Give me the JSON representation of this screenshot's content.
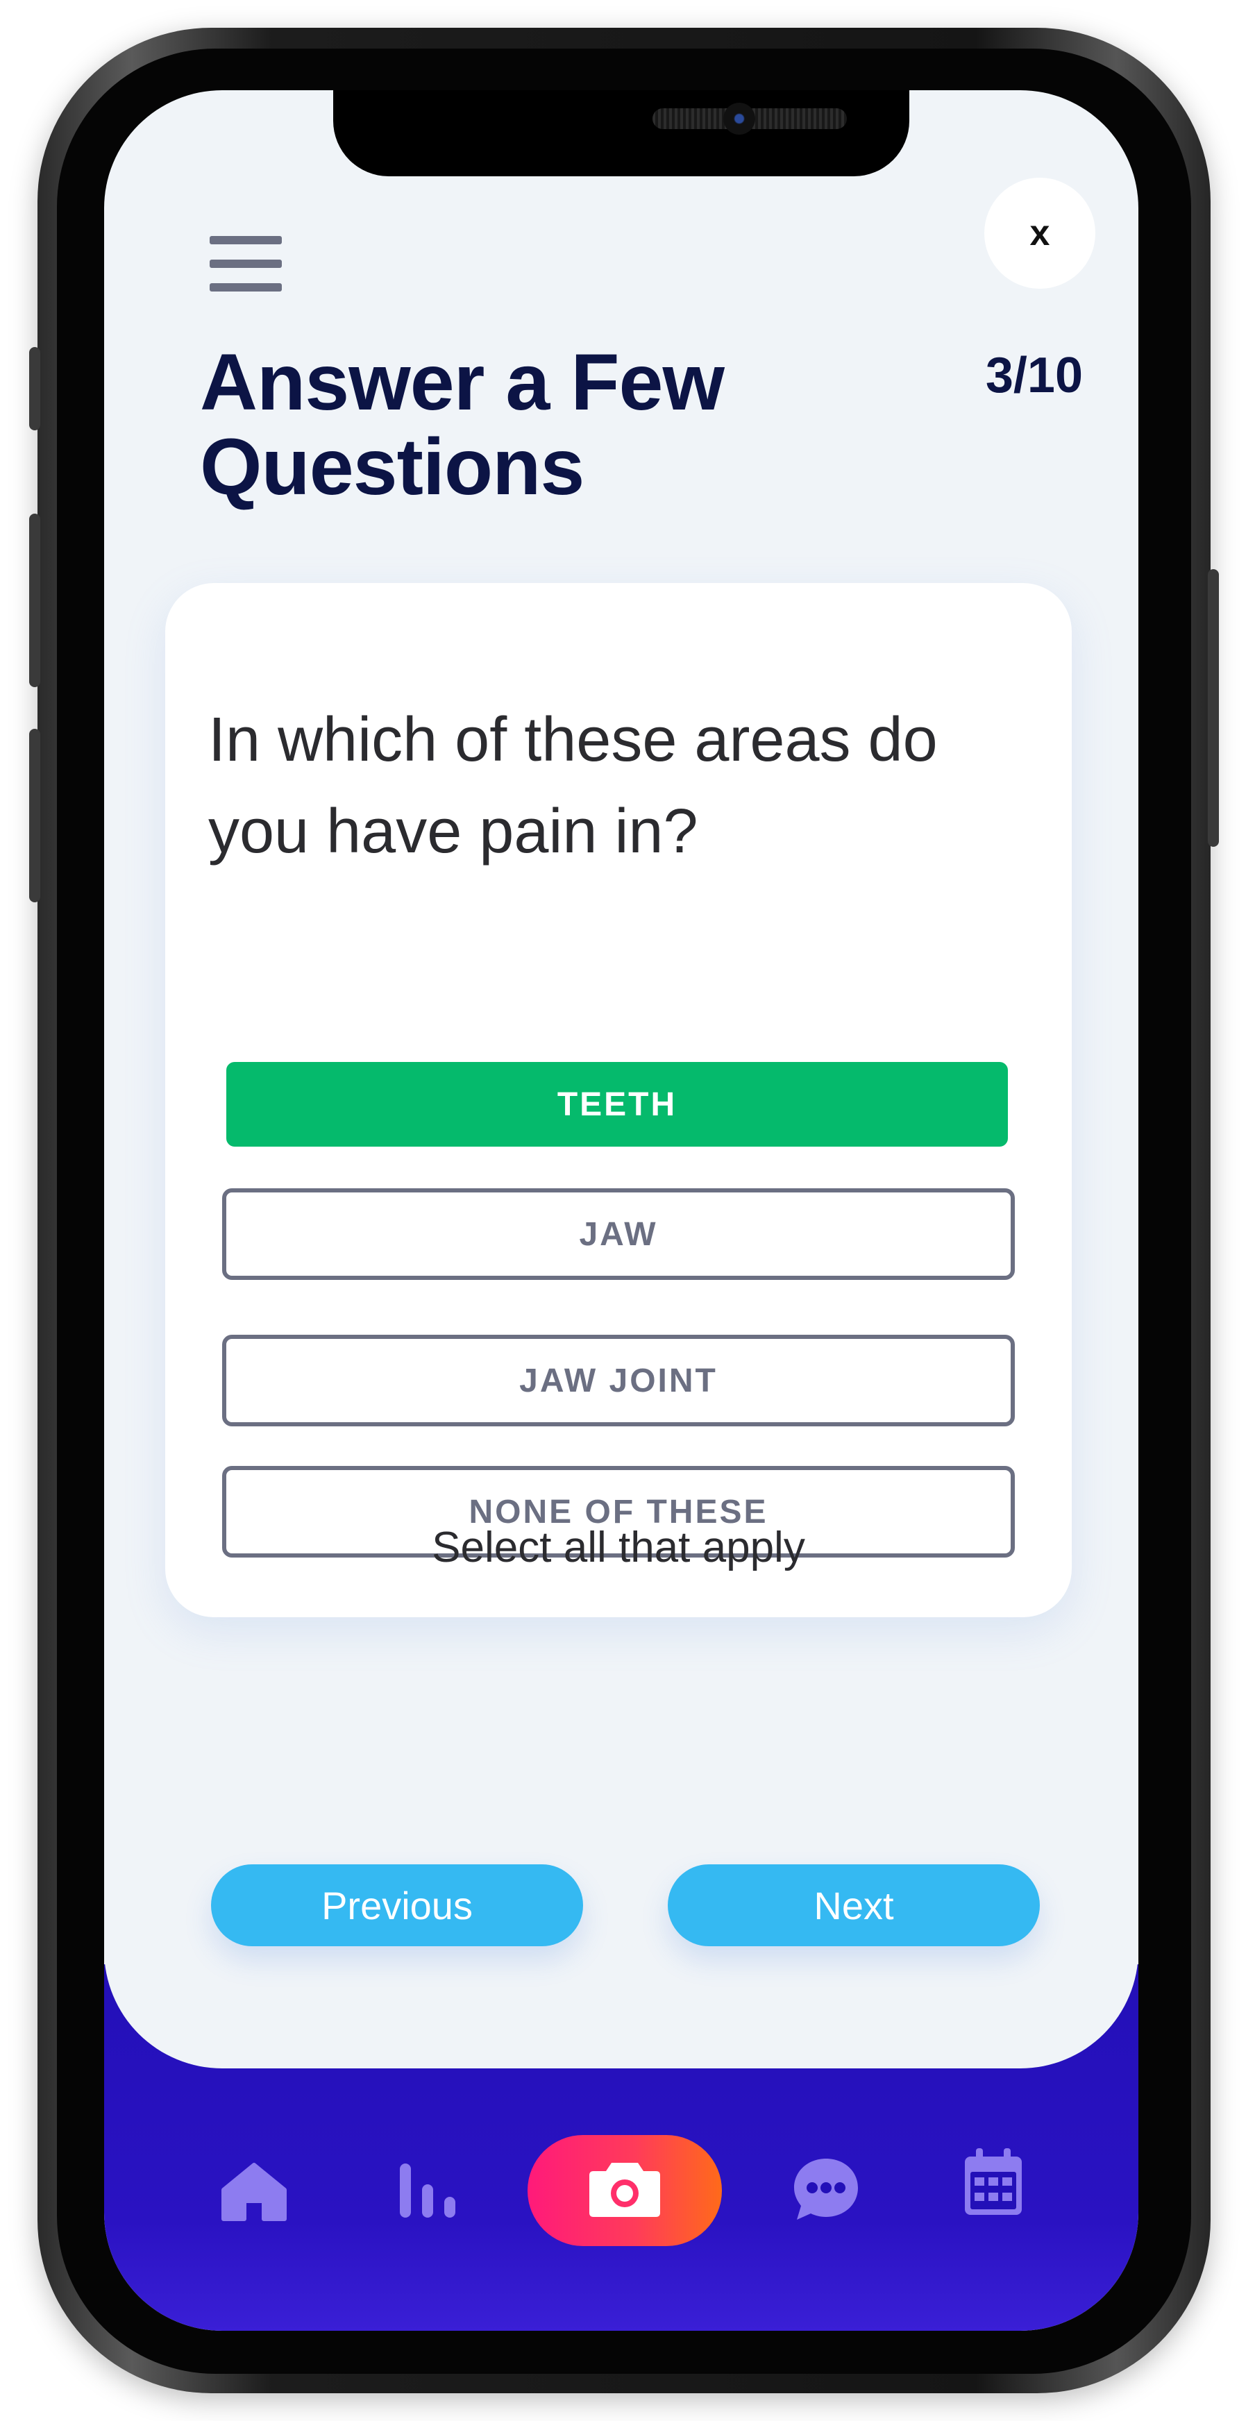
{
  "header": {
    "close_label": "x",
    "title": "Answer a Few Questions",
    "progress": "3/10"
  },
  "question": {
    "text": "In which of these areas do you have pain in?",
    "options": [
      {
        "label": "TEETH",
        "selected": true
      },
      {
        "label": "JAW",
        "selected": false
      },
      {
        "label": "JAW JOINT",
        "selected": false
      },
      {
        "label": "NONE OF THESE",
        "selected": false
      }
    ],
    "helper": "Select all that apply"
  },
  "navigation": {
    "previous_label": "Previous",
    "next_label": "Next"
  },
  "tabbar": {
    "items": [
      {
        "icon": "home-icon"
      },
      {
        "icon": "stats-icon"
      },
      {
        "icon": "camera-icon"
      },
      {
        "icon": "chat-icon"
      },
      {
        "icon": "calendar-icon"
      }
    ]
  },
  "colors": {
    "title": "#0c1445",
    "selected": "#05ba6c",
    "option_border": "#6b6f82",
    "nav_button": "#35b9f2",
    "tabbar_bg": "#2310b8",
    "tab_icon": "#8d7cf0",
    "camera_gradient_start": "#ff1a7a",
    "camera_gradient_end": "#ff6a1a"
  }
}
